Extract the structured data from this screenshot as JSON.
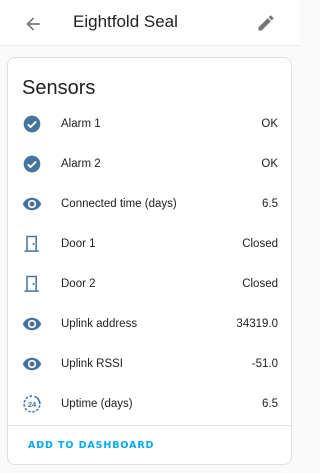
{
  "header": {
    "title": "Eightfold Seal",
    "back_icon": "arrow-left-icon",
    "edit_icon": "pencil-icon"
  },
  "card": {
    "title": "Sensors",
    "rows": [
      {
        "icon": "check-circle-icon",
        "name": "Alarm 1",
        "value": "OK"
      },
      {
        "icon": "check-circle-icon",
        "name": "Alarm 2",
        "value": "OK"
      },
      {
        "icon": "eye-icon",
        "name": "Connected time (days)",
        "value": "6.5"
      },
      {
        "icon": "door-icon",
        "name": "Door 1",
        "value": "Closed"
      },
      {
        "icon": "door-icon",
        "name": "Door 2",
        "value": "Closed"
      },
      {
        "icon": "eye-icon",
        "name": "Uplink address",
        "value": "34319.0"
      },
      {
        "icon": "eye-icon",
        "name": "Uplink RSSI",
        "value": "-51.0"
      },
      {
        "icon": "hours-24-icon",
        "name": "Uptime (days)",
        "value": "6.5"
      }
    ],
    "action_label": "ADD TO DASHBOARD"
  },
  "colors": {
    "icon": "#44739e",
    "accent": "#03a9f4",
    "header_icon": "#757575"
  }
}
